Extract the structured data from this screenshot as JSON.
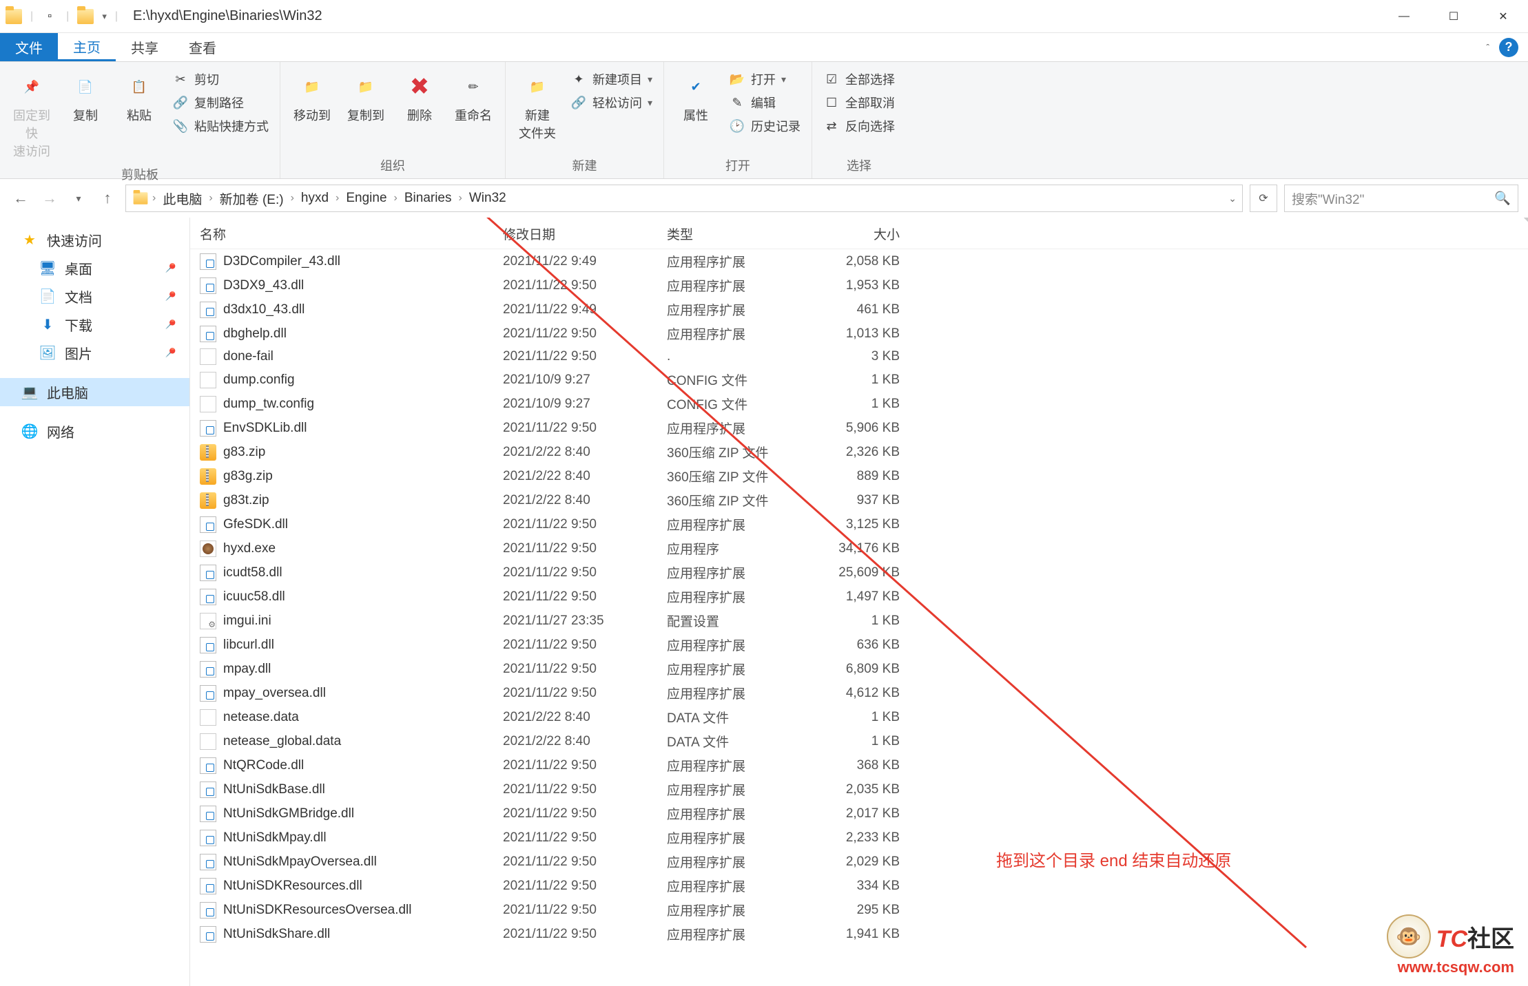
{
  "title_path": "E:\\hyxd\\Engine\\Binaries\\Win32",
  "tabs": {
    "file": "文件",
    "home": "主页",
    "share": "共享",
    "view": "查看"
  },
  "ribbon": {
    "clipboard": {
      "pin": "固定到快\n速访问",
      "copy": "复制",
      "paste": "粘贴",
      "cut": "剪切",
      "copy_path": "复制路径",
      "paste_shortcut": "粘贴快捷方式",
      "group": "剪贴板"
    },
    "organize": {
      "move_to": "移动到",
      "copy_to": "复制到",
      "delete": "删除",
      "rename": "重命名",
      "group": "组织"
    },
    "new": {
      "new_folder": "新建\n文件夹",
      "new_item": "新建项目",
      "easy_access": "轻松访问",
      "group": "新建"
    },
    "open": {
      "properties": "属性",
      "open": "打开",
      "edit": "编辑",
      "history": "历史记录",
      "group": "打开"
    },
    "select": {
      "select_all": "全部选择",
      "select_none": "全部取消",
      "invert": "反向选择",
      "group": "选择"
    }
  },
  "breadcrumb": [
    "此电脑",
    "新加卷 (E:)",
    "hyxd",
    "Engine",
    "Binaries",
    "Win32"
  ],
  "search_placeholder": "搜索\"Win32\"",
  "sidebar": {
    "quick": "快速访问",
    "desktop": "桌面",
    "documents": "文档",
    "downloads": "下载",
    "pictures": "图片",
    "this_pc": "此电脑",
    "network": "网络"
  },
  "columns": {
    "name": "名称",
    "date": "修改日期",
    "type": "类型",
    "size": "大小"
  },
  "files": [
    {
      "icon": "dll",
      "name": "D3DCompiler_43.dll",
      "date": "2021/11/22 9:49",
      "type": "应用程序扩展",
      "size": "2,058 KB"
    },
    {
      "icon": "dll",
      "name": "D3DX9_43.dll",
      "date": "2021/11/22 9:50",
      "type": "应用程序扩展",
      "size": "1,953 KB"
    },
    {
      "icon": "dll",
      "name": "d3dx10_43.dll",
      "date": "2021/11/22 9:49",
      "type": "应用程序扩展",
      "size": "461 KB"
    },
    {
      "icon": "dll",
      "name": "dbghelp.dll",
      "date": "2021/11/22 9:50",
      "type": "应用程序扩展",
      "size": "1,013 KB"
    },
    {
      "icon": "blank",
      "name": "done-fail",
      "date": "2021/11/22 9:50",
      "type": ".",
      "size": "3 KB"
    },
    {
      "icon": "blank",
      "name": "dump.config",
      "date": "2021/10/9 9:27",
      "type": "CONFIG 文件",
      "size": "1 KB"
    },
    {
      "icon": "blank",
      "name": "dump_tw.config",
      "date": "2021/10/9 9:27",
      "type": "CONFIG 文件",
      "size": "1 KB"
    },
    {
      "icon": "dll",
      "name": "EnvSDKLib.dll",
      "date": "2021/11/22 9:50",
      "type": "应用程序扩展",
      "size": "5,906 KB"
    },
    {
      "icon": "zip",
      "name": "g83.zip",
      "date": "2021/2/22 8:40",
      "type": "360压缩 ZIP 文件",
      "size": "2,326 KB"
    },
    {
      "icon": "zip",
      "name": "g83g.zip",
      "date": "2021/2/22 8:40",
      "type": "360压缩 ZIP 文件",
      "size": "889 KB"
    },
    {
      "icon": "zip",
      "name": "g83t.zip",
      "date": "2021/2/22 8:40",
      "type": "360压缩 ZIP 文件",
      "size": "937 KB"
    },
    {
      "icon": "dll",
      "name": "GfeSDK.dll",
      "date": "2021/11/22 9:50",
      "type": "应用程序扩展",
      "size": "3,125 KB"
    },
    {
      "icon": "exe",
      "name": "hyxd.exe",
      "date": "2021/11/22 9:50",
      "type": "应用程序",
      "size": "34,176 KB"
    },
    {
      "icon": "dll",
      "name": "icudt58.dll",
      "date": "2021/11/22 9:50",
      "type": "应用程序扩展",
      "size": "25,609 KB"
    },
    {
      "icon": "dll",
      "name": "icuuc58.dll",
      "date": "2021/11/22 9:50",
      "type": "应用程序扩展",
      "size": "1,497 KB"
    },
    {
      "icon": "cfg",
      "name": "imgui.ini",
      "date": "2021/11/27 23:35",
      "type": "配置设置",
      "size": "1 KB"
    },
    {
      "icon": "dll",
      "name": "libcurl.dll",
      "date": "2021/11/22 9:50",
      "type": "应用程序扩展",
      "size": "636 KB"
    },
    {
      "icon": "dll",
      "name": "mpay.dll",
      "date": "2021/11/22 9:50",
      "type": "应用程序扩展",
      "size": "6,809 KB"
    },
    {
      "icon": "dll",
      "name": "mpay_oversea.dll",
      "date": "2021/11/22 9:50",
      "type": "应用程序扩展",
      "size": "4,612 KB"
    },
    {
      "icon": "blank",
      "name": "netease.data",
      "date": "2021/2/22 8:40",
      "type": "DATA 文件",
      "size": "1 KB"
    },
    {
      "icon": "blank",
      "name": "netease_global.data",
      "date": "2021/2/22 8:40",
      "type": "DATA 文件",
      "size": "1 KB"
    },
    {
      "icon": "dll",
      "name": "NtQRCode.dll",
      "date": "2021/11/22 9:50",
      "type": "应用程序扩展",
      "size": "368 KB"
    },
    {
      "icon": "dll",
      "name": "NtUniSdkBase.dll",
      "date": "2021/11/22 9:50",
      "type": "应用程序扩展",
      "size": "2,035 KB"
    },
    {
      "icon": "dll",
      "name": "NtUniSdkGMBridge.dll",
      "date": "2021/11/22 9:50",
      "type": "应用程序扩展",
      "size": "2,017 KB"
    },
    {
      "icon": "dll",
      "name": "NtUniSdkMpay.dll",
      "date": "2021/11/22 9:50",
      "type": "应用程序扩展",
      "size": "2,233 KB"
    },
    {
      "icon": "dll",
      "name": "NtUniSdkMpayOversea.dll",
      "date": "2021/11/22 9:50",
      "type": "应用程序扩展",
      "size": "2,029 KB"
    },
    {
      "icon": "dll",
      "name": "NtUniSDKResources.dll",
      "date": "2021/11/22 9:50",
      "type": "应用程序扩展",
      "size": "334 KB"
    },
    {
      "icon": "dll",
      "name": "NtUniSDKResourcesOversea.dll",
      "date": "2021/11/22 9:50",
      "type": "应用程序扩展",
      "size": "295 KB"
    },
    {
      "icon": "dll",
      "name": "NtUniSdkShare.dll",
      "date": "2021/11/22 9:50",
      "type": "应用程序扩展",
      "size": "1,941 KB"
    }
  ],
  "annotation": "拖到这个目录 end 结束自动还原",
  "watermark": {
    "brand_a": "TC",
    "brand_b": "社区",
    "url": "www.tcsqw.com"
  }
}
